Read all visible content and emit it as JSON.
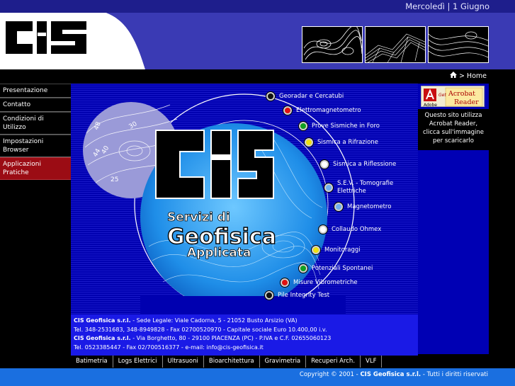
{
  "header": {
    "date": "Mercoledì | 1 Giugno",
    "logo": "CIS",
    "thumbnails": [
      "contour-map-thumbnail",
      "3d-surface-thumbnail",
      "topographic-thumbnail"
    ]
  },
  "breadcrumb": {
    "home_label": "> Home"
  },
  "sidebar": {
    "items": [
      {
        "label": "Presentazione",
        "active": false
      },
      {
        "label": "Contatto",
        "active": false
      },
      {
        "label": "Condizioni di Utilizzo",
        "active": false
      },
      {
        "label": "Impostazioni Browser",
        "active": false
      },
      {
        "label": "Applicazioni Pratiche",
        "active": true
      }
    ]
  },
  "hero": {
    "title_line1": "Servizi di",
    "title_line2": "Geofisica",
    "title_line3": "Applicata",
    "contour_numbers": [
      "48",
      "30",
      "44",
      "40",
      "25"
    ]
  },
  "services": [
    {
      "label": "Georadar e Cercatubi",
      "color": "#111111"
    },
    {
      "label": "Elettromagnetometro",
      "color": "#e01010"
    },
    {
      "label": "Prove Sismiche in Foro",
      "color": "#10a020"
    },
    {
      "label": "Sismica a Rifrazione",
      "color": "#f0e010"
    },
    {
      "label": "Sismica a Riflessione",
      "color": "#ffffff"
    },
    {
      "label": "S.E.V. - Tomografie Elettriche",
      "color": "#70b0f0"
    },
    {
      "label": "Magnetometro",
      "color": "#70b0f0"
    },
    {
      "label": "Collaudo Ohmex",
      "color": "#ffffff"
    },
    {
      "label": "Monitoraggi",
      "color": "#f0e010"
    },
    {
      "label": "Potenziali Spontanei",
      "color": "#10a020"
    },
    {
      "label": "Misure Vibrometriche",
      "color": "#e01010"
    },
    {
      "label": "Pile Integrity Test",
      "color": "#111111"
    }
  ],
  "company": {
    "line1_name": "CIS Geofisica s.r.l.",
    "line1_rest": " - Sede Legale: Viale Cadorna, 5 - 21052 Busto Arsizio (VA)",
    "line2": "Tel. 348-2531683, 348-8949828 - Fax 02700520970 - Capitale sociale Euro 10.400,00 i.v.",
    "line3_name": "CIS Geofisica s.r.l.",
    "line3_rest": " - Via Borghetto, 80 - 29100 PIACENZA (PC) - P.IVA e C.F. 02655060123",
    "line4": "Tel. 0523385447 - Fax 02/700516377 - e-mail: info@cis-geofisica.it"
  },
  "acrobat": {
    "get_label": "Get",
    "brand": "Acrobat",
    "product": "Reader",
    "adobe": "Adobe",
    "note": "Questo sito utilizza Acrobat Reader, clicca sull'immagine per scaricarlo"
  },
  "bottom_nav": [
    "Batimetria",
    "Logs Elettrici",
    "Ultrasuoni",
    "Bioarchitettura",
    "Gravimetria",
    "Recuperi Arch.",
    "VLF"
  ],
  "copyright": {
    "prefix": "Copyright © 2001 - ",
    "name": "CIS Geofisica s.r.l.",
    "suffix": " - Tutti i diritti riservati"
  },
  "colors": {
    "header_blue": "#3a3ab4",
    "main_blue": "#0000b0",
    "active_red": "#9b0c14",
    "copy_blue": "#1a6fe0"
  }
}
